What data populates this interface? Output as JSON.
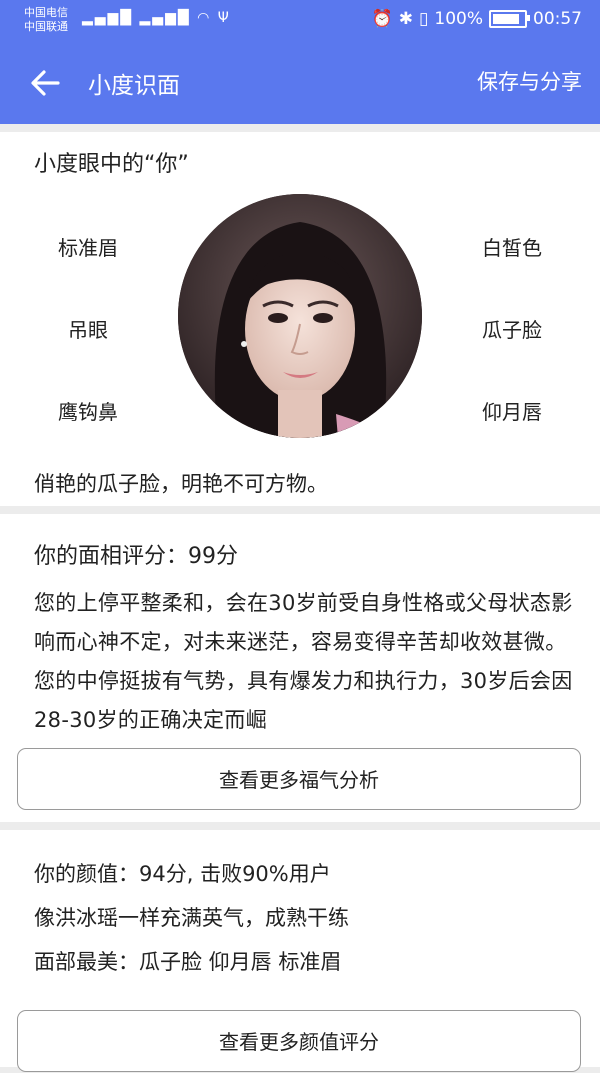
{
  "status_bar": {
    "carrier1": "中国电信",
    "carrier2": "中国联通",
    "battery": "100%",
    "time": "00:57"
  },
  "appbar": {
    "title": "小度识面",
    "action": "保存与分享"
  },
  "features_card": {
    "heading": "小度眼中的“你”",
    "left": [
      "标准眉",
      "吊眼",
      "鹰钩鼻"
    ],
    "right": [
      "白皙色",
      "瓜子脸",
      "仰月唇"
    ],
    "summary": "俏艳的瓜子脸，明艳不可方物。"
  },
  "face_reading": {
    "heading": "你的面相评分：99分",
    "description": "您的上停平整柔和，会在30岁前受自身性格或父母状态影响而心神不定，对未来迷茫，容易变得辛苦却收效甚微。您的中停挺拔有气势，具有爆发力和执行力，30岁后会因28-30岁的正确决定而崛",
    "button": "查看更多福气分析"
  },
  "beauty": {
    "score_line": "你的颜值：94分, 击败90%用户",
    "compare_line": "像洪冰瑶一样充满英气，成熟干练",
    "best_line": "面部最美：瓜子脸 仰月唇 标准眉",
    "button": "查看更多颜值评分"
  }
}
